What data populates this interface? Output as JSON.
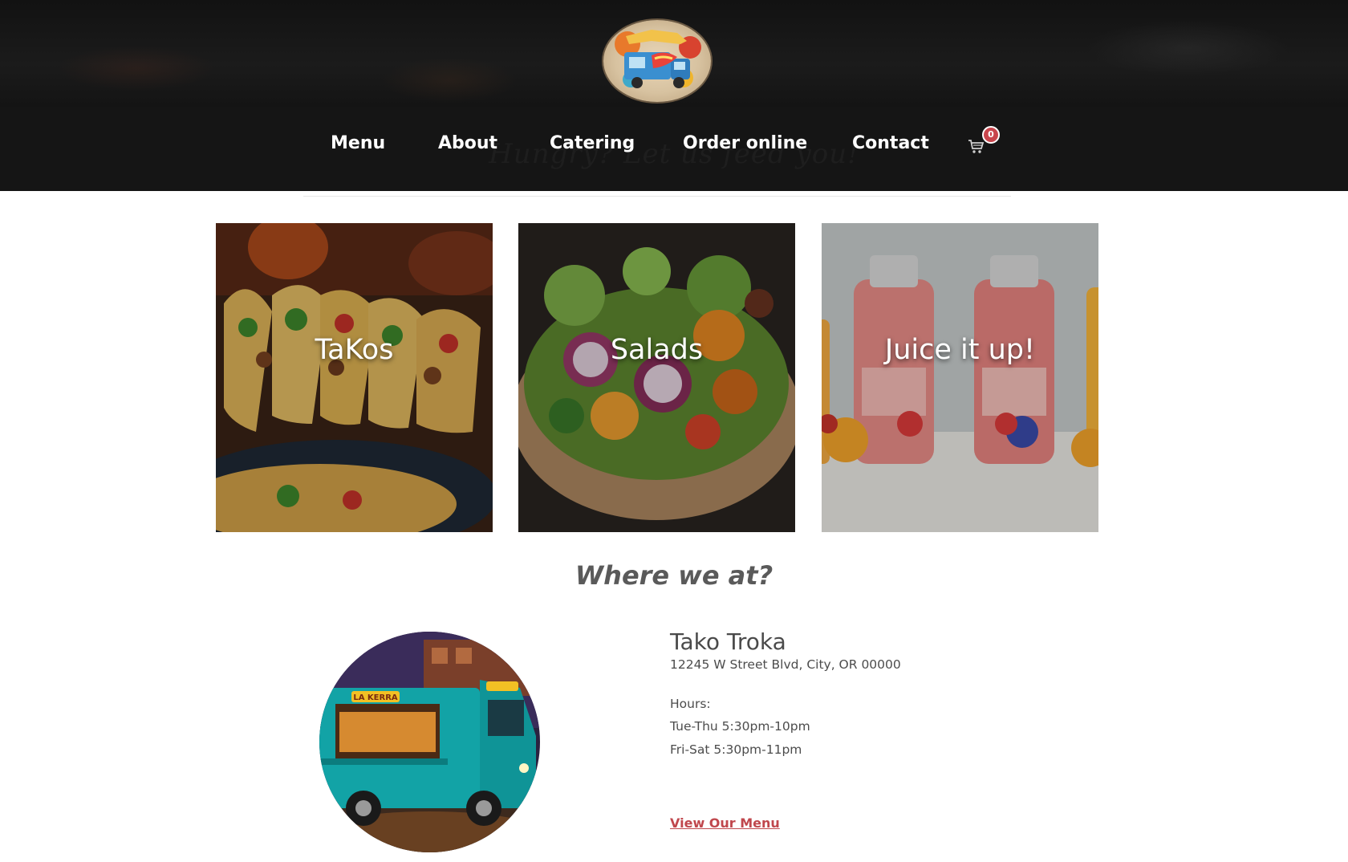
{
  "header": {
    "logo_alt": "Tako Troka logo",
    "ghost_text": "Hungry? Let us feed you!"
  },
  "nav": {
    "items": [
      {
        "label": "Menu"
      },
      {
        "label": "About"
      },
      {
        "label": "Catering"
      },
      {
        "label": "Order online"
      },
      {
        "label": "Contact"
      }
    ],
    "cart_count": "0"
  },
  "tiles": [
    {
      "label": "TaKos"
    },
    {
      "label": "Salads"
    },
    {
      "label": "Juice it up!"
    }
  ],
  "location": {
    "heading": "Where we at?",
    "name": "Tako Troka",
    "address": "12245 W Street Blvd, City, OR 00000",
    "hours_label": "Hours:",
    "hours_weekday": "Tue-Thu 5:30pm-10pm",
    "hours_weekend": "Fri-Sat 5:30pm-11pm",
    "menu_link": "View Our Menu",
    "truck_sign": "LA KERRA"
  },
  "colors": {
    "header_bg": "#151515",
    "badge": "#c8454c",
    "link": "#c0474d"
  },
  "icons": {
    "cart": "shopping-cart-icon"
  }
}
